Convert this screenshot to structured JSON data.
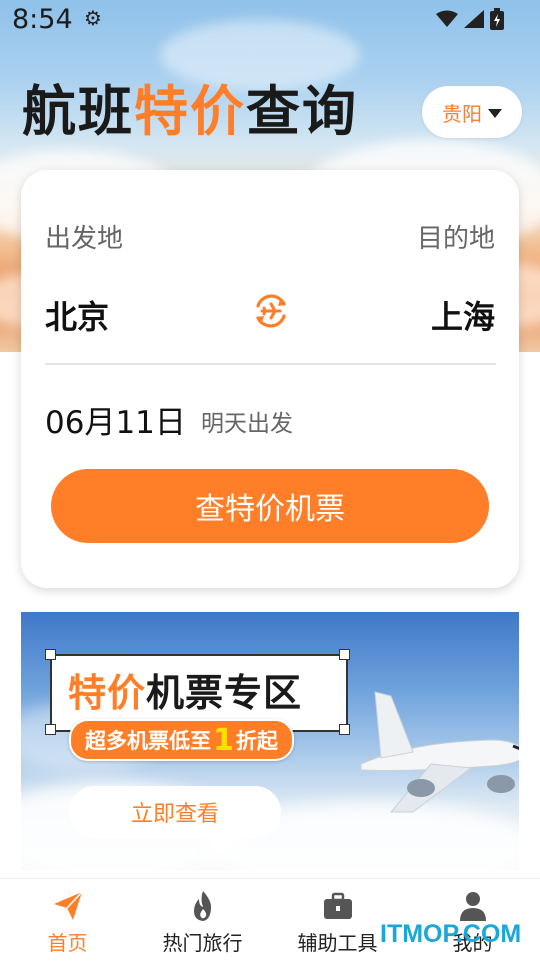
{
  "status_bar": {
    "time": "8:54"
  },
  "header": {
    "title_part1": "航班",
    "title_part2": "特价",
    "title_part3": "查询",
    "city": "贵阳"
  },
  "search_card": {
    "departure_label": "出发地",
    "destination_label": "目的地",
    "departure_city": "北京",
    "destination_city": "上海",
    "date": "06月11日",
    "date_hint": "明天出发",
    "search_button": "查特价机票"
  },
  "banner": {
    "title_orange": "特价",
    "title_dark": "机票专区",
    "pill_prefix": "超多机票低至",
    "pill_number": "1",
    "pill_suffix": "折起",
    "view_button": "立即查看"
  },
  "bottom_nav": {
    "items": [
      {
        "label": "首页",
        "icon": "paper-plane-icon",
        "active": true
      },
      {
        "label": "热门旅行",
        "icon": "flame-icon",
        "active": false
      },
      {
        "label": "辅助工具",
        "icon": "briefcase-icon",
        "active": false
      },
      {
        "label": "我的",
        "icon": "user-icon",
        "active": false
      }
    ]
  },
  "watermark": "ITMOP.COM",
  "colors": {
    "accent": "#ff7e27",
    "text": "#111111",
    "muted": "#666666"
  }
}
